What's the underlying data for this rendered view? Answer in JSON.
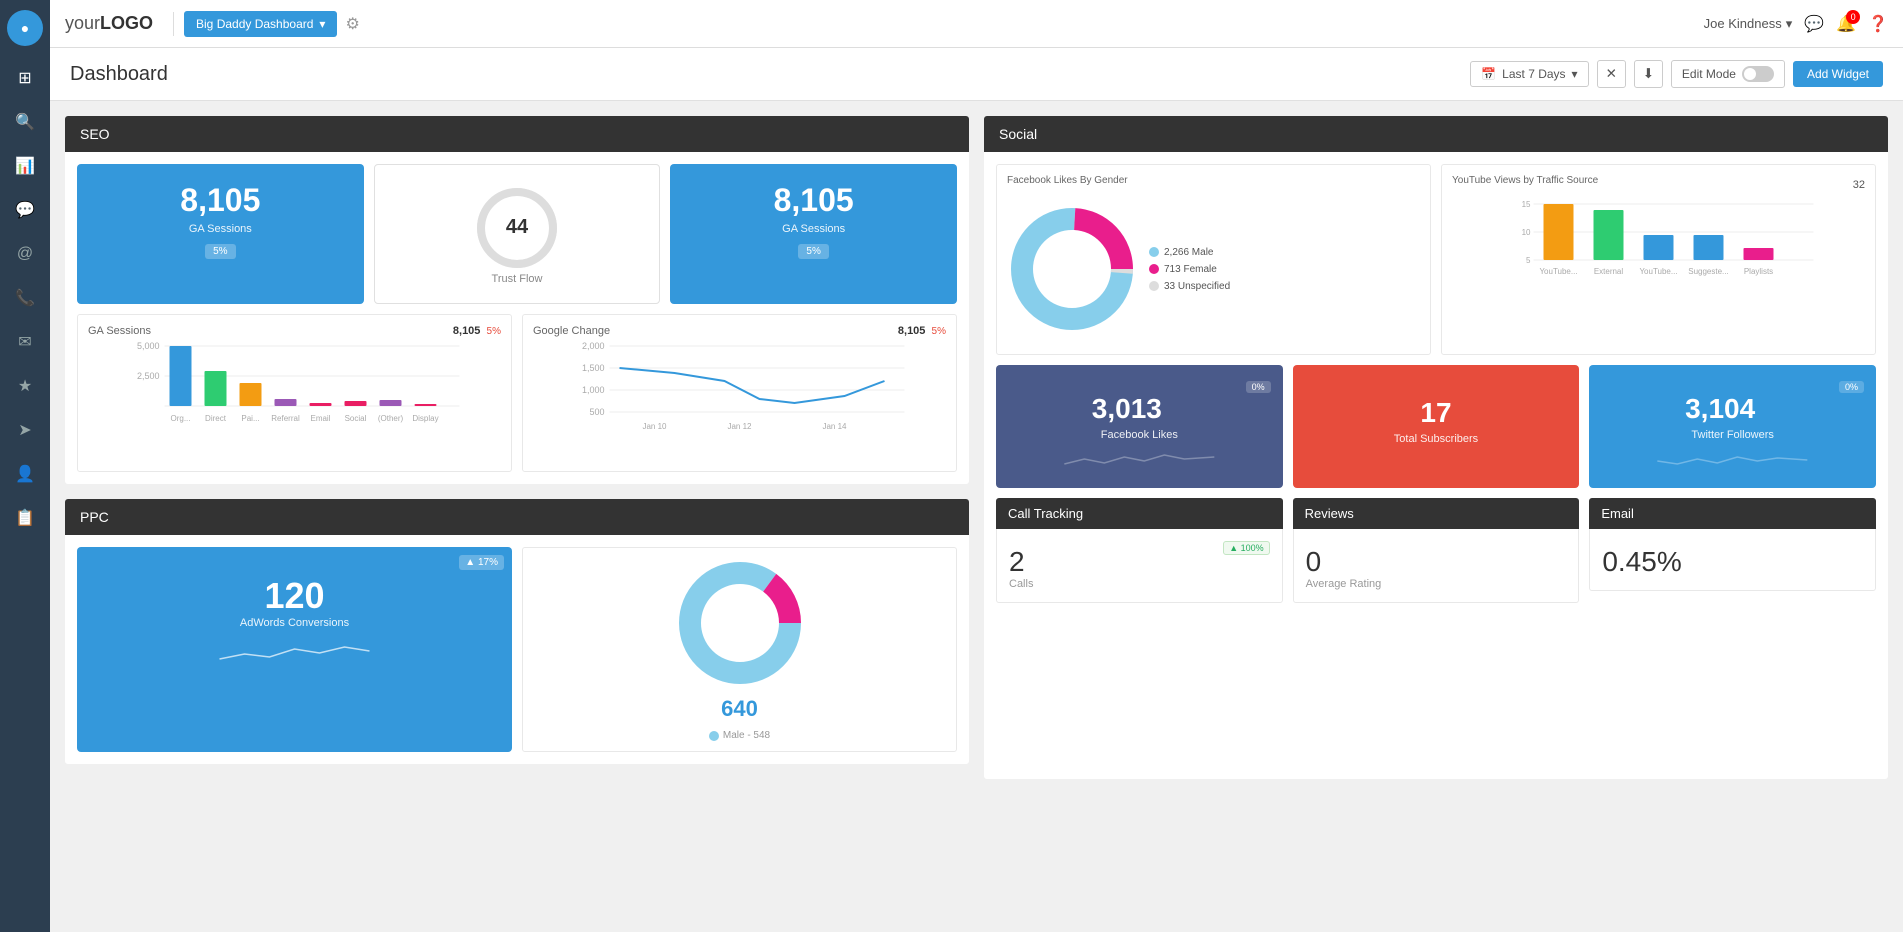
{
  "app": {
    "logo_text": "your",
    "logo_bold": "LOGO"
  },
  "topnav": {
    "dashboard_btn": "Big Daddy Dashboard",
    "user_name": "Joe Kindness",
    "notification_count": "0"
  },
  "page": {
    "title": "Dashboard",
    "date_filter": "Last 7 Days",
    "edit_mode_label": "Edit Mode",
    "add_widget_label": "Add Widget"
  },
  "seo": {
    "section_title": "SEO",
    "card1_value": "8,105",
    "card1_label": "GA Sessions",
    "card1_badge": "5%",
    "trust_value": "44",
    "trust_label": "Trust Flow",
    "card3_value": "8,105",
    "card3_label": "GA Sessions",
    "card3_badge": "5%",
    "ga_sessions_title": "GA Sessions",
    "ga_sessions_value": "8,105",
    "ga_sessions_pct": "5%",
    "google_change_title": "Google Change",
    "google_change_value": "8,105",
    "google_change_pct": "5%",
    "bar_labels": [
      "Org...",
      "Direct",
      "Pai...",
      "Referral",
      "Email",
      "Social",
      "(Other)",
      "Display"
    ],
    "bar_values": [
      100,
      60,
      45,
      20,
      5,
      8,
      10,
      5
    ],
    "bar_colors": [
      "#3498db",
      "#2ecc71",
      "#f39c12",
      "#9b59b6",
      "#e91e63",
      "#e91e63",
      "#9b59b6",
      "#e91e63"
    ],
    "y_labels": [
      "5,000",
      "2,500"
    ],
    "line_y_labels": [
      "2,000",
      "1,500",
      "1,000",
      "500"
    ],
    "line_x_labels": [
      "Jan 10",
      "Jan 12",
      "Jan 14"
    ]
  },
  "ppc": {
    "section_title": "PPC",
    "adwords_value": "120",
    "adwords_label": "AdWords Conversions",
    "adwords_badge": "▲ 17%",
    "donut_value": "640",
    "male_label": "Male - 548"
  },
  "social": {
    "section_title": "Social",
    "fb_gender_title": "Facebook Likes By Gender",
    "male_count": "2,266 Male",
    "female_count": "713 Female",
    "unspecified_count": "33 Unspecified",
    "yt_title": "YouTube Views by Traffic Source",
    "yt_count": "32",
    "yt_bar_labels": [
      "YouTube...",
      "External",
      "YouTube...",
      "Suggeste...",
      "Playlists"
    ],
    "yt_bar_values": [
      14,
      12,
      6,
      6,
      3
    ],
    "yt_bar_colors": [
      "#f39c12",
      "#2ecc71",
      "#3498db",
      "#3498db",
      "#e91e63"
    ],
    "yt_y_labels": [
      "15",
      "10",
      "5"
    ],
    "fb_likes_value": "3,013",
    "fb_likes_label": "Facebook Likes",
    "fb_likes_badge": "0%",
    "subscribers_value": "17",
    "subscribers_label": "Total Subscribers",
    "twitter_value": "3,104",
    "twitter_label": "Twitter Followers",
    "twitter_badge": "0%",
    "call_tracking_title": "Call Tracking",
    "reviews_title": "Reviews",
    "email_title": "Email",
    "calls_value": "2",
    "calls_label": "Calls",
    "calls_badge": "▲ 100%",
    "avg_rating_value": "0",
    "avg_rating_label": "Average Rating",
    "email_value": "0.45%"
  }
}
